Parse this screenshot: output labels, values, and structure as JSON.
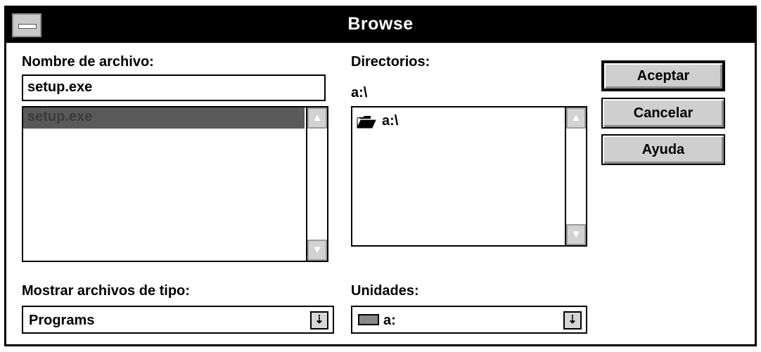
{
  "window": {
    "title": "Browse"
  },
  "filename": {
    "label": "Nombre de archivo:",
    "value": "setup.exe",
    "files": [
      "setup.exe"
    ]
  },
  "directories": {
    "label": "Directorios:",
    "current": "a:\\",
    "items": [
      "a:\\"
    ]
  },
  "file_type": {
    "label": "Mostrar archivos de tipo:",
    "value": "Programs"
  },
  "drives": {
    "label": "Unidades:",
    "value": "a:"
  },
  "buttons": {
    "ok": "Aceptar",
    "cancel": "Cancelar",
    "help": "Ayuda"
  },
  "icons": {
    "scroll_up": "▲",
    "scroll_down": "▼",
    "dropdown": "⇣"
  }
}
